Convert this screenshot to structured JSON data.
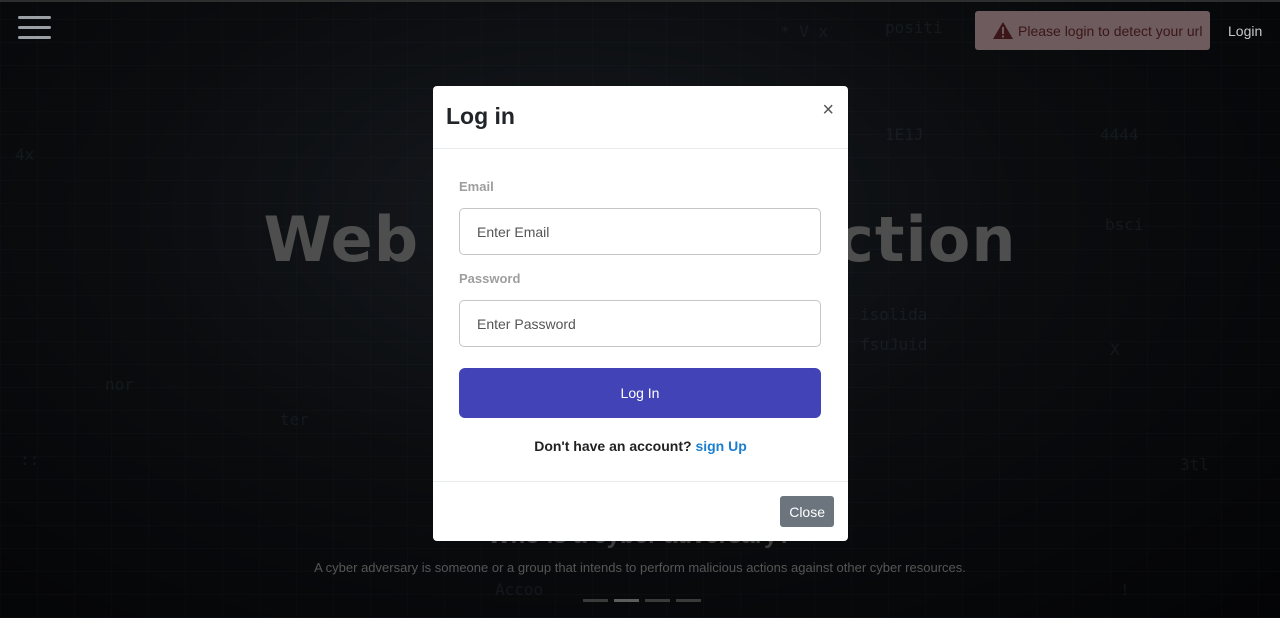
{
  "nav": {
    "alert_text": "Please login to detect your url",
    "login_label": "Login"
  },
  "hero": {
    "title": "Web ... ction",
    "title_left": "Web",
    "title_right": "ction"
  },
  "carousel": {
    "heading": "Who is a cyber adversary?",
    "caption": "A cyber adversary is someone or a group that intends to perform malicious actions against other cyber resources.",
    "indicator_count": 4,
    "active_index": 1
  },
  "modal": {
    "title": "Log in",
    "close_symbol": "×",
    "email_label": "Email",
    "email_placeholder": "Enter Email",
    "password_label": "Password",
    "password_placeholder": "Enter Password",
    "submit_label": "Log In",
    "signup_prompt": "Don't have an account?",
    "signup_link": "sign Up",
    "close_label": "Close"
  },
  "colors": {
    "primary_button": "#4343b8",
    "link": "#1a7fd0",
    "alert_bg": "#6e5b5d",
    "secondary_button": "#6c757d"
  },
  "icons": [
    "hamburger-icon",
    "warning-icon",
    "close-icon"
  ]
}
